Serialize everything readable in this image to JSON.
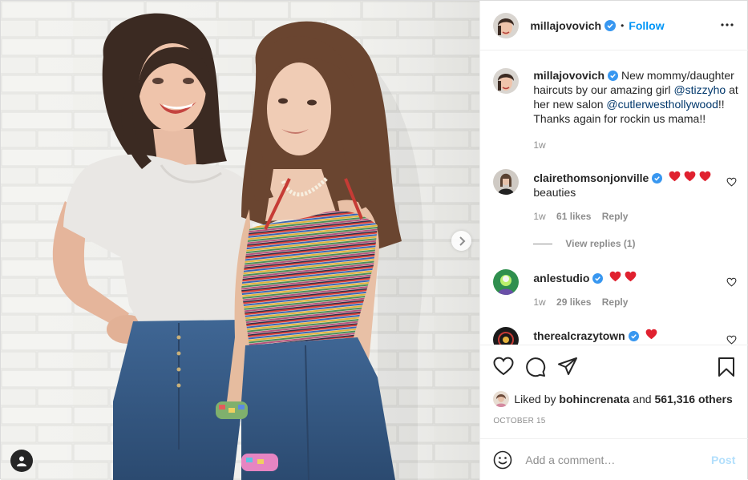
{
  "post": {
    "author": "millajovovich",
    "follow_label": "Follow",
    "separator": "•",
    "caption": {
      "text_1": "New mommy/daughter haircuts by our amazing girl ",
      "mention_1": "@stizzyho",
      "text_2": " at her new salon ",
      "mention_2": "@cutlerwesthollywood",
      "text_3": "!! Thanks again for rockin us mama!!",
      "time": "1w"
    },
    "comments": [
      {
        "user": "clairethomsonjonville",
        "hearts": 3,
        "text": "beauties",
        "time": "1w",
        "likes": "61 likes",
        "reply": "Reply",
        "view_replies": "View replies (1)"
      },
      {
        "user": "anlestudio",
        "hearts": 2,
        "text": "",
        "time": "1w",
        "likes": "29 likes",
        "reply": "Reply"
      },
      {
        "user": "therealcrazytown",
        "hearts": 1,
        "text": ""
      }
    ],
    "liked_by_prefix": "Liked by ",
    "liked_by_user": "bohincrenata",
    "liked_by_and": " and ",
    "liked_by_count": "561,316 others",
    "date": "OCTOBER 15",
    "comment_placeholder": "Add a comment…",
    "post_label": "Post"
  },
  "colors": {
    "link_blue": "#0095f6",
    "mention": "#00376b",
    "heart_red": "#ed4956",
    "muted": "#8e8e8e",
    "verified": "#3897f0"
  },
  "icons": [
    "heart-icon",
    "comment-icon",
    "share-icon",
    "bookmark-icon",
    "more-icon",
    "verified-icon",
    "emoji-icon",
    "chevron-right-icon",
    "user-tag-icon"
  ]
}
